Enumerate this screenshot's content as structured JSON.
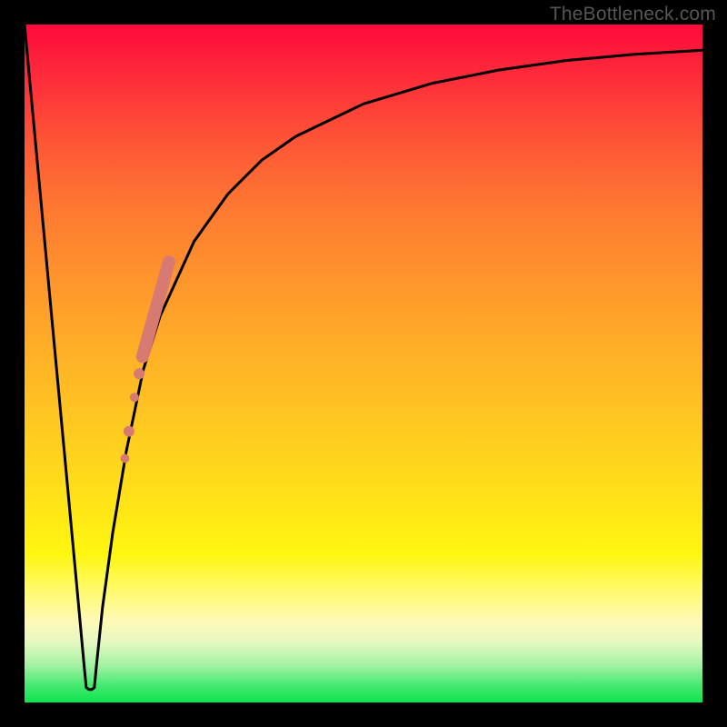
{
  "attribution": "TheBottleneck.com",
  "colors": {
    "frame": "#000000",
    "curve": "#000000",
    "marker": "#d77a71",
    "gradient_top": "#fe0a3c",
    "gradient_bottom": "#0ee44e"
  },
  "chart_data": {
    "type": "line",
    "title": "",
    "xlabel": "",
    "ylabel": "",
    "xlim": [
      0,
      100
    ],
    "ylim": [
      0,
      100
    ],
    "grid": false,
    "curve": {
      "description": "V-shaped bottleneck curve: sharp drop to ~0 near x≈9.7 with small flat floor, then steep rise tapering to a high plateau",
      "x": [
        0,
        2,
        4,
        6,
        8,
        8.8,
        9.1,
        9.5,
        9.9,
        10.3,
        10.6,
        11.5,
        13,
        15,
        17.5,
        20,
        25,
        30,
        35,
        40,
        50,
        60,
        70,
        80,
        90,
        100
      ],
      "y": [
        100,
        78.5,
        57,
        35.5,
        14,
        5.4,
        2.2,
        1.9,
        1.9,
        2.2,
        5.4,
        14,
        25,
        37,
        49,
        57,
        68,
        75,
        80,
        83.5,
        88.3,
        91.3,
        93.3,
        94.7,
        95.6,
        96.2
      ]
    },
    "markers": {
      "description": "Salmon dotted segment on the rising limb",
      "points": [
        {
          "x": 14.8,
          "y": 36,
          "r": 5
        },
        {
          "x": 15.4,
          "y": 40,
          "r": 6
        },
        {
          "x": 16.2,
          "y": 45,
          "r": 5
        },
        {
          "x": 16.9,
          "y": 48.5,
          "r": 6
        }
      ],
      "segment": {
        "x1": 17.4,
        "y1": 51,
        "x2": 21.3,
        "y2": 65,
        "width": 14
      }
    }
  }
}
